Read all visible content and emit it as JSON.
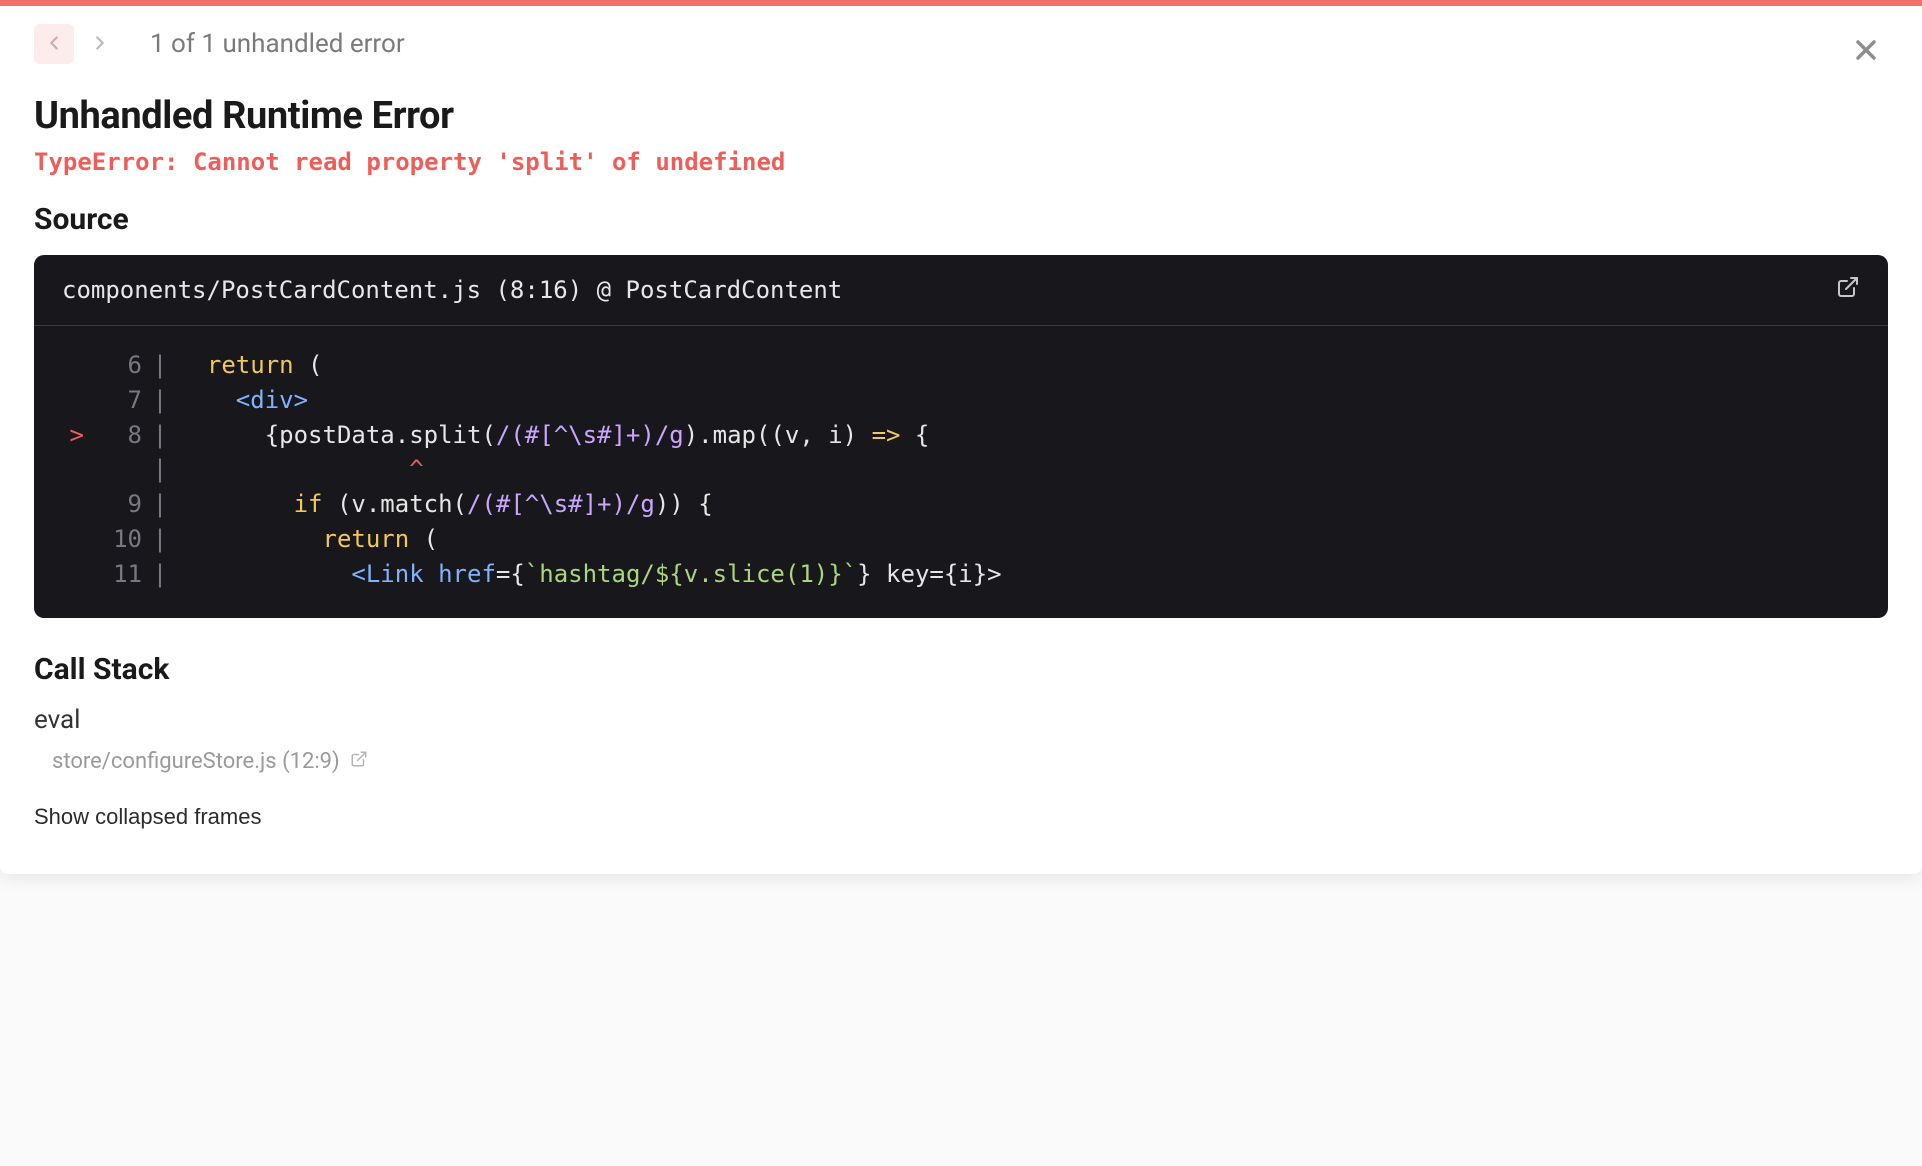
{
  "header": {
    "counter_text": "1 of 1 unhandled error"
  },
  "error": {
    "title": "Unhandled Runtime Error",
    "message": "TypeError: Cannot read property 'split' of undefined"
  },
  "source": {
    "heading": "Source",
    "location": "components/PostCardContent.js (8:16) @ PostCardContent",
    "error_line_number": 8,
    "caret_indent": "                ^",
    "lines": [
      {
        "num": "6",
        "indent": "  ",
        "a": "return",
        "b": " ("
      },
      {
        "num": "7",
        "indent": "    ",
        "a": "<div>"
      },
      {
        "num": "8",
        "indent": "      ",
        "a": "{postData.split(",
        "b": "/(#[^\\s#]+)/g",
        "c": ").map((v, i) ",
        "d": "=>",
        "e": " {"
      },
      {
        "num": "9",
        "indent": "        ",
        "a": "if",
        "b": " (v.match(",
        "c": "/(#[^\\s#]+)/g",
        "d": ")) {"
      },
      {
        "num": "10",
        "indent": "          ",
        "a": "return",
        "b": " ("
      },
      {
        "num": "11",
        "indent": "            ",
        "a": "<Link",
        "b": " href",
        "c": "={",
        "d": "`hashtag/${v.slice(1)}`",
        "e": "} key={i}>"
      }
    ]
  },
  "call_stack": {
    "heading": "Call Stack",
    "frames": [
      {
        "fn": "eval",
        "loc": "store/configureStore.js (12:9)"
      }
    ],
    "show_collapsed_label": "Show collapsed frames"
  }
}
